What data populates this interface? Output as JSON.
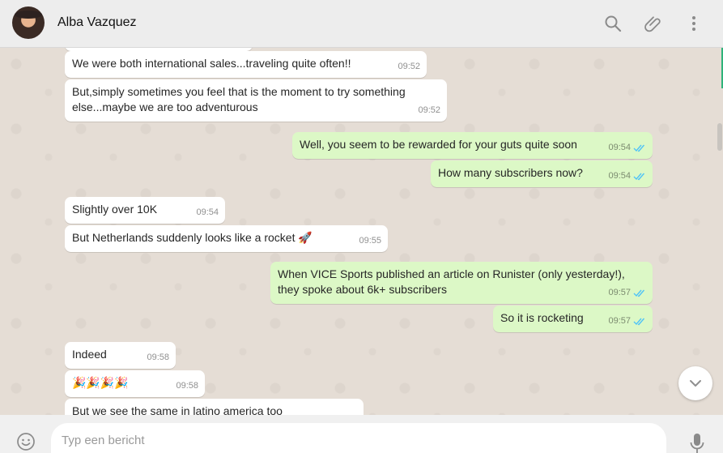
{
  "contact": {
    "name": "Alba Vazquez"
  },
  "messages": [
    {
      "dir": "in",
      "text": "",
      "time": ""
    },
    {
      "dir": "in",
      "text": "We were both international sales...traveling quite often!!",
      "time": "09:52"
    },
    {
      "dir": "in",
      "text": "But,simply sometimes you feel that is the moment to try something\nelse...maybe we are too adventurous",
      "time": "09:52"
    },
    {
      "dir": "out",
      "text": "Well, you seem to be rewarded for your guts quite soon",
      "time": "09:54",
      "status": "read"
    },
    {
      "dir": "out",
      "text": "How many subscribers now?",
      "time": "09:54",
      "status": "read"
    },
    {
      "dir": "in",
      "text": "Slightly over 10K",
      "time": "09:54"
    },
    {
      "dir": "in",
      "text": "But Netherlands suddenly looks like a rocket 🚀",
      "time": "09:55"
    },
    {
      "dir": "out",
      "text": "When VICE Sports published an article on Runister (only yesterday!),\nthey spoke about 6k+ subscribers",
      "time": "09:57",
      "status": "read"
    },
    {
      "dir": "out",
      "text": "So it is rocketing",
      "time": "09:57",
      "status": "read"
    },
    {
      "dir": "in",
      "text": "Indeed",
      "time": "09:58"
    },
    {
      "dir": "in",
      "text": "🎉🎉🎉🎉",
      "time": "09:58"
    },
    {
      "dir": "in",
      "text": "But we see the same in latino america too",
      "time": ""
    }
  ],
  "composer": {
    "placeholder": "Typ een bericht"
  },
  "icons": {
    "search": "search-icon",
    "attach": "paperclip-icon",
    "menu": "more-vertical-icon",
    "emoji": "emoji-icon",
    "mic": "microphone-icon",
    "scroll_down": "chevron-down-icon",
    "read_receipt": "double-check-icon"
  },
  "colors": {
    "incoming_bubble": "#ffffff",
    "outgoing_bubble": "#dcf8c6",
    "read_ticks": "#4fc3f7",
    "chat_background": "#e5ddd5",
    "header_background": "#ededed"
  }
}
